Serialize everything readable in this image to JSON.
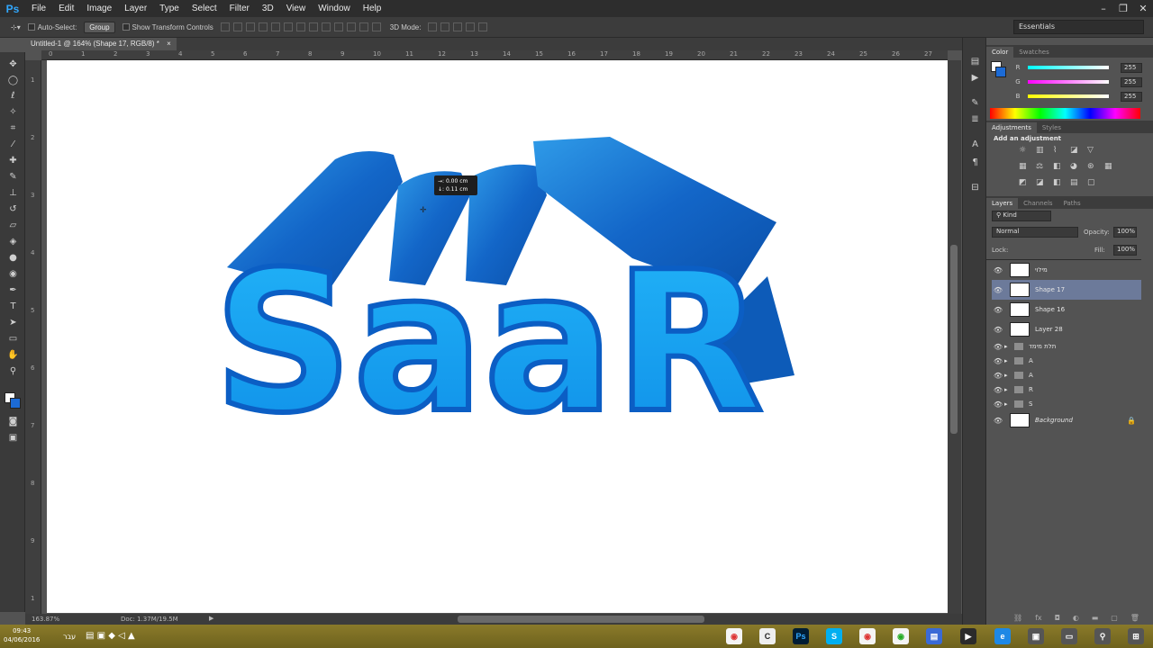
{
  "app": {
    "logo": "Ps"
  },
  "menu": [
    "File",
    "Edit",
    "Image",
    "Layer",
    "Type",
    "Select",
    "Filter",
    "3D",
    "View",
    "Window",
    "Help"
  ],
  "options": {
    "auto_select_label": "Auto-Select:",
    "auto_select_value": "Group",
    "transform_label": "Show Transform Controls",
    "mode_3d_label": "3D Mode:",
    "workspace": "Essentials"
  },
  "document": {
    "tab_title": "Untitled-1 @ 164% (Shape 17, RGB/8) *",
    "zoom": "163.87%",
    "doc_size": "Doc: 1.37M/19.5M"
  },
  "ruler": {
    "top_ticks": [
      "0",
      "1",
      "2",
      "3",
      "4",
      "5",
      "6",
      "7",
      "8",
      "9",
      "10",
      "11",
      "12",
      "13",
      "14",
      "15",
      "16",
      "17",
      "18",
      "19",
      "20",
      "21",
      "22",
      "23",
      "24",
      "25",
      "26",
      "27"
    ],
    "left_ticks": [
      "1",
      "2",
      "3",
      "4",
      "5",
      "6",
      "7",
      "8",
      "9",
      "1"
    ]
  },
  "canvas": {
    "artwork_text": "SaaR",
    "tooltip_line1": "→: 0.00 cm",
    "tooltip_line2": "↓: 0.11 cm"
  },
  "color_panel": {
    "tabs": [
      "Color",
      "Swatches"
    ],
    "channels": [
      {
        "label": "R",
        "value": "255"
      },
      {
        "label": "G",
        "value": "255"
      },
      {
        "label": "B",
        "value": "255"
      }
    ]
  },
  "adjustments_panel": {
    "tabs": [
      "Adjustments",
      "Styles"
    ],
    "heading": "Add an adjustment"
  },
  "layers_panel": {
    "tabs": [
      "Layers",
      "Channels",
      "Paths"
    ],
    "filter_kind": "Kind",
    "blend_mode": "Normal",
    "opacity_label": "Opacity:",
    "opacity_value": "100%",
    "lock_label": "Lock:",
    "fill_label": "Fill:",
    "fill_value": "100%",
    "layers": [
      {
        "name": "מילוי",
        "type": "thumb-text",
        "selected": false
      },
      {
        "name": "Shape 17",
        "type": "thumb-empty",
        "selected": true
      },
      {
        "name": "Shape 16",
        "type": "thumb-empty",
        "selected": false
      },
      {
        "name": "Layer 28",
        "type": "thumb-text",
        "selected": false
      },
      {
        "name": "תלת מימד",
        "type": "folder",
        "selected": false
      },
      {
        "name": "A",
        "type": "folder",
        "selected": false
      },
      {
        "name": "A",
        "type": "folder",
        "selected": false
      },
      {
        "name": "R",
        "type": "folder",
        "selected": false
      },
      {
        "name": "S",
        "type": "folder",
        "selected": false
      },
      {
        "name": "Background",
        "type": "thumb-white",
        "selected": false
      }
    ]
  },
  "taskbar": {
    "time": "09:43",
    "date": "04/06/2016",
    "lang": "עבר"
  }
}
